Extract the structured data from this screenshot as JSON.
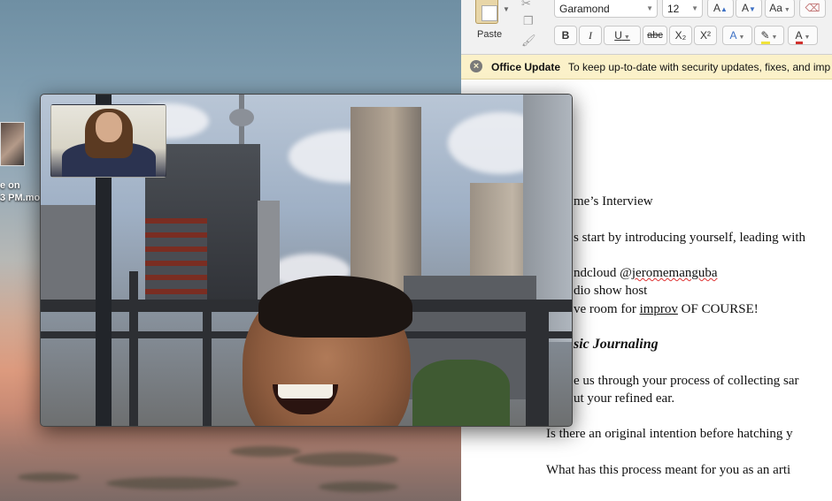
{
  "desktop": {
    "file_label_line1": "e on",
    "file_label_line2": "3 PM.mo"
  },
  "word": {
    "ribbon": {
      "paste_label": "Paste",
      "font_name": "Garamond",
      "font_size": "12",
      "bold": "B",
      "italic": "I",
      "underline": "U",
      "strikethrough": "abc",
      "subscript": "X₂",
      "superscript": "X²",
      "grow_font": "A",
      "shrink_font": "A",
      "change_case": "Aa",
      "text_effects": "A",
      "highlight": "✎",
      "font_color": "A"
    },
    "info_bar": {
      "title": "Office Update",
      "message": "To keep up-to-date with security updates, fixes, and imp"
    },
    "document": {
      "heading": "me’s Interview",
      "intro_prompt": "s start by introducing yourself, leading with",
      "soundcloud_prefix": "ndcloud @",
      "soundcloud_handle": "jeromemanguba",
      "role": "dio show host",
      "improv_prefix": "ve room for ",
      "improv_word": "improv",
      "improv_suffix": " OF COURSE!",
      "section_heading": "sic Journaling",
      "q1_line1": "e us through your process of collecting sar",
      "q1_line2": "ut your refined ear.",
      "q2": "Is there an original intention before hatching y",
      "q3": "What has this process meant for you as an arti"
    }
  }
}
